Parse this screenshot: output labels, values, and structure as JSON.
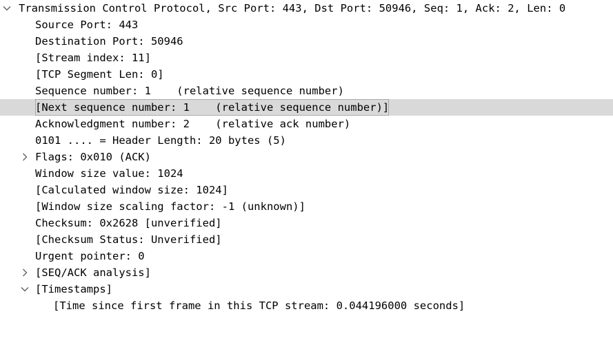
{
  "packet_details": {
    "tcp_header": "Transmission Control Protocol, Src Port: 443, Dst Port: 50946, Seq: 1, Ack: 2, Len: 0",
    "source_port": "Source Port: 443",
    "destination_port": "Destination Port: 50946",
    "stream_index": "[Stream index: 11]",
    "segment_len": "[TCP Segment Len: 0]",
    "sequence_number": "Sequence number: 1    (relative sequence number)",
    "next_sequence_number": "[Next sequence number: 1    (relative sequence number)]",
    "ack_number": "Acknowledgment number: 2    (relative ack number)",
    "header_length": "0101 .... = Header Length: 20 bytes (5)",
    "flags": "Flags: 0x010 (ACK)",
    "window_size_value": "Window size value: 1024",
    "calculated_window_size": "[Calculated window size: 1024]",
    "window_scaling_factor": "[Window size scaling factor: -1 (unknown)]",
    "checksum": "Checksum: 0x2628 [unverified]",
    "checksum_status": "[Checksum Status: Unverified]",
    "urgent_pointer": "Urgent pointer: 0",
    "seq_ack_analysis": "[SEQ/ACK analysis]",
    "timestamps": "[Timestamps]",
    "time_since_first_frame": "[Time since first frame in this TCP stream: 0.044196000 seconds]"
  },
  "icons": {
    "expanded": "chevron-down-icon",
    "collapsed": "chevron-right-icon"
  },
  "colors": {
    "selected_row": "#d9d9d9",
    "text": "#000000",
    "chevron": "#5f5f5f"
  }
}
